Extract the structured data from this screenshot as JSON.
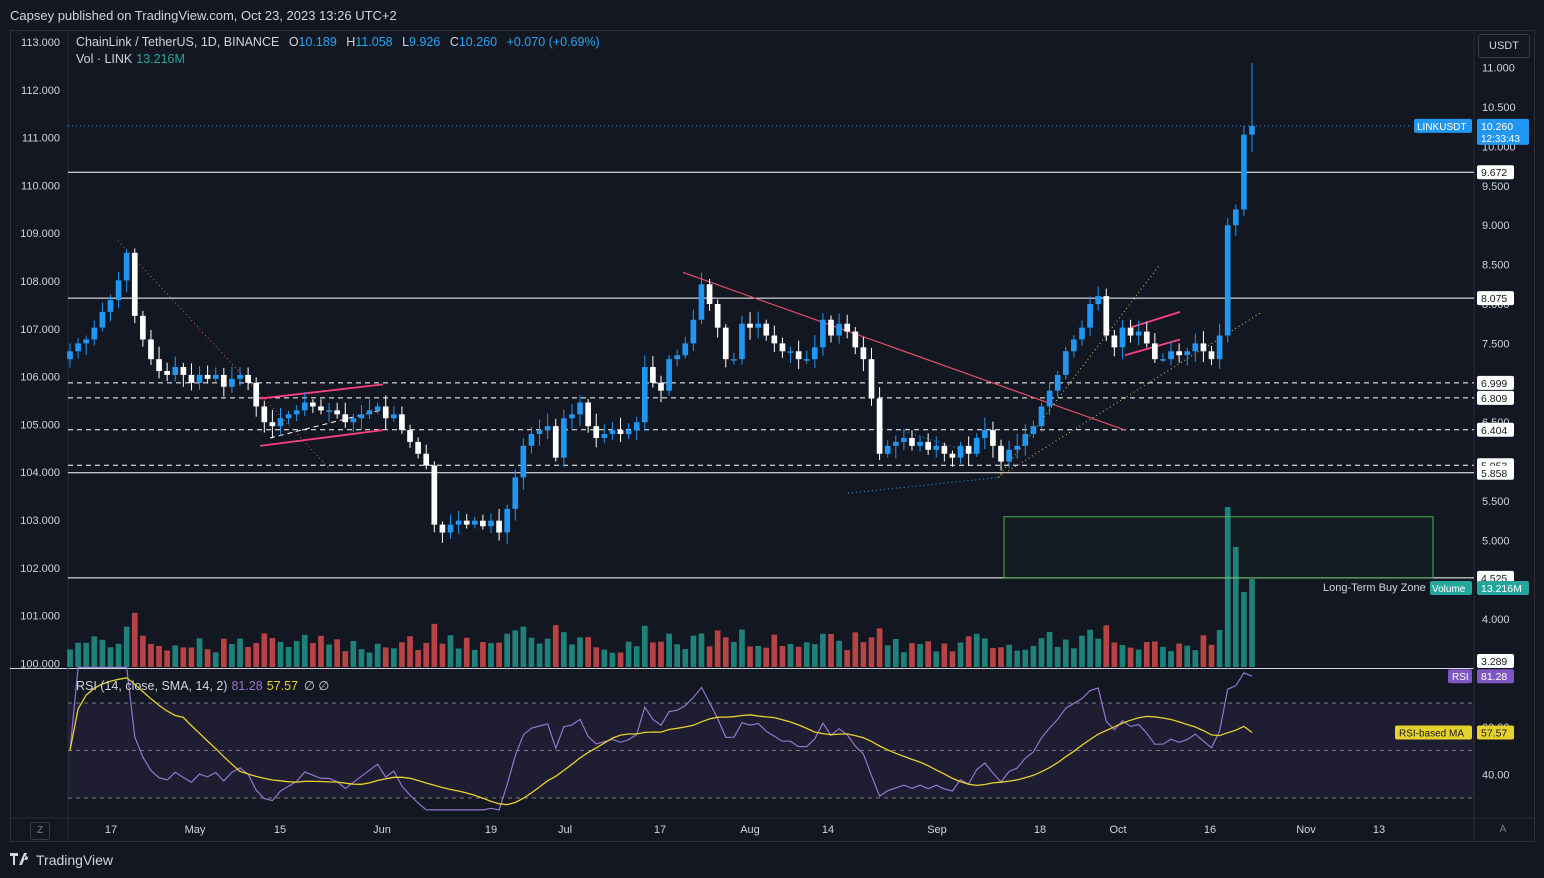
{
  "header": {
    "published": "Capsey published on TradingView.com, Oct 23, 2023 13:26 UTC+2"
  },
  "legend": {
    "symbol": "ChainLink / TetherUS, 1D, BINANCE",
    "o_label": "O",
    "o": "10.189",
    "h_label": "H",
    "h": "11.058",
    "l_label": "L",
    "l": "9.926",
    "c_label": "C",
    "c": "10.260",
    "change": "+0.070 (+0.69%)",
    "vol_label": "Vol · LINK",
    "vol": "13.216M"
  },
  "rsi_legend": {
    "label": "RSI (14, close, SMA, 14, 2)",
    "rsi": "81.28",
    "ma": "57.57",
    "extra": "∅ ∅"
  },
  "currency_button": "USDT",
  "footer": {
    "brand": "TradingView",
    "logo_icon": "tradingview-logo-icon"
  },
  "corner_left": "Z",
  "corner_right": "A",
  "colors": {
    "up": "#2196f3",
    "down": "#ffffff",
    "vol_up": "#26a69a",
    "vol_down": "#ef5350",
    "rsi": "#9575cd",
    "rsi_ma": "#e6d22c",
    "background": "#131722"
  },
  "chart_data": [
    {
      "type": "candlestick",
      "left_axis_ticks": [
        "113.000",
        "112.000",
        "111.000",
        "110.000",
        "109.000",
        "108.000",
        "107.000",
        "106.000",
        "105.000",
        "104.000",
        "103.000",
        "102.000",
        "101.000",
        "100.000"
      ],
      "right_axis_ticks": [
        "11.000",
        "10.500",
        "10.000",
        "9.500",
        "9.000",
        "8.500",
        "8.000",
        "7.500",
        "7.000",
        "6.500",
        "5.500",
        "5.000",
        "4.000",
        "3.500"
      ],
      "x_ticks": [
        "17",
        "May",
        "15",
        "Jun",
        "19",
        "Jul",
        "17",
        "Aug",
        "14",
        "Sep",
        "18",
        "Oct",
        "16",
        "Nov",
        "13"
      ],
      "levels": [
        {
          "value": 9.672,
          "label": "9.672",
          "style": "solid"
        },
        {
          "value": 8.075,
          "label": "8.075",
          "style": "solid"
        },
        {
          "value": 6.999,
          "label": "6.999",
          "style": "dashed"
        },
        {
          "value": 6.809,
          "label": "6.809",
          "style": "dashed"
        },
        {
          "value": 6.404,
          "label": "6.404",
          "style": "dashed"
        },
        {
          "value": 5.953,
          "label": "5.953",
          "style": "dashed"
        },
        {
          "value": 5.858,
          "label": "5.858",
          "style": "solid"
        },
        {
          "value": 4.525,
          "label": "4.525",
          "style": "solid"
        }
      ],
      "price_tag": {
        "symbol": "LINKUSDT",
        "price": "10.260",
        "countdown": "12:33:43"
      },
      "volume_tag": {
        "label": "Volume",
        "value": "13.216M"
      },
      "lowest_tag": "3.289",
      "zone_label": "Long-Term Buy Zone",
      "closes": [
        7.4,
        7.5,
        7.55,
        7.7,
        7.9,
        8.05,
        8.3,
        8.65,
        7.85,
        7.55,
        7.3,
        7.15,
        7.1,
        7.2,
        7.1,
        7.0,
        7.1,
        7.05,
        7.1,
        6.95,
        7.05,
        7.1,
        7.0,
        6.7,
        6.5,
        6.45,
        6.55,
        6.6,
        6.65,
        6.75,
        6.7,
        6.65,
        6.65,
        6.6,
        6.5,
        6.55,
        6.6,
        6.65,
        6.7,
        6.55,
        6.6,
        6.4,
        6.25,
        6.1,
        5.95,
        5.2,
        5.1,
        5.2,
        5.25,
        5.2,
        5.25,
        5.18,
        5.25,
        5.1,
        5.4,
        5.8,
        6.2,
        6.35,
        6.4,
        6.45,
        6.05,
        6.55,
        6.6,
        6.75,
        6.45,
        6.3,
        6.35,
        6.4,
        6.35,
        6.4,
        6.5,
        7.2,
        7.0,
        6.9,
        7.3,
        7.35,
        7.5,
        7.8,
        8.25,
        8.0,
        7.7,
        7.3,
        7.3,
        7.75,
        7.7,
        7.75,
        7.6,
        7.5,
        7.4,
        7.4,
        7.3,
        7.3,
        7.45,
        7.8,
        7.6,
        7.75,
        7.65,
        7.45,
        7.3,
        6.8,
        6.1,
        6.2,
        6.25,
        6.3,
        6.2,
        6.25,
        6.15,
        6.2,
        6.1,
        6.05,
        6.2,
        6.1,
        6.3,
        6.4,
        6.2,
        6.0,
        6.15,
        6.2,
        6.35,
        6.45,
        6.7,
        6.9,
        7.1,
        7.4,
        7.55,
        7.7,
        8.0,
        8.1,
        7.6,
        7.45,
        7.7,
        7.6,
        7.65,
        7.5,
        7.3,
        7.3,
        7.4,
        7.35,
        7.4,
        7.5,
        7.4,
        7.3,
        7.6,
        9.0,
        9.2,
        10.15,
        10.26
      ],
      "rsi_ticks": [
        "60.00",
        "40.00"
      ],
      "rsi_tags": [
        {
          "label": "RSI",
          "value": "81.28"
        },
        {
          "label": "RSI-based MA",
          "value": "57.57"
        }
      ]
    }
  ]
}
